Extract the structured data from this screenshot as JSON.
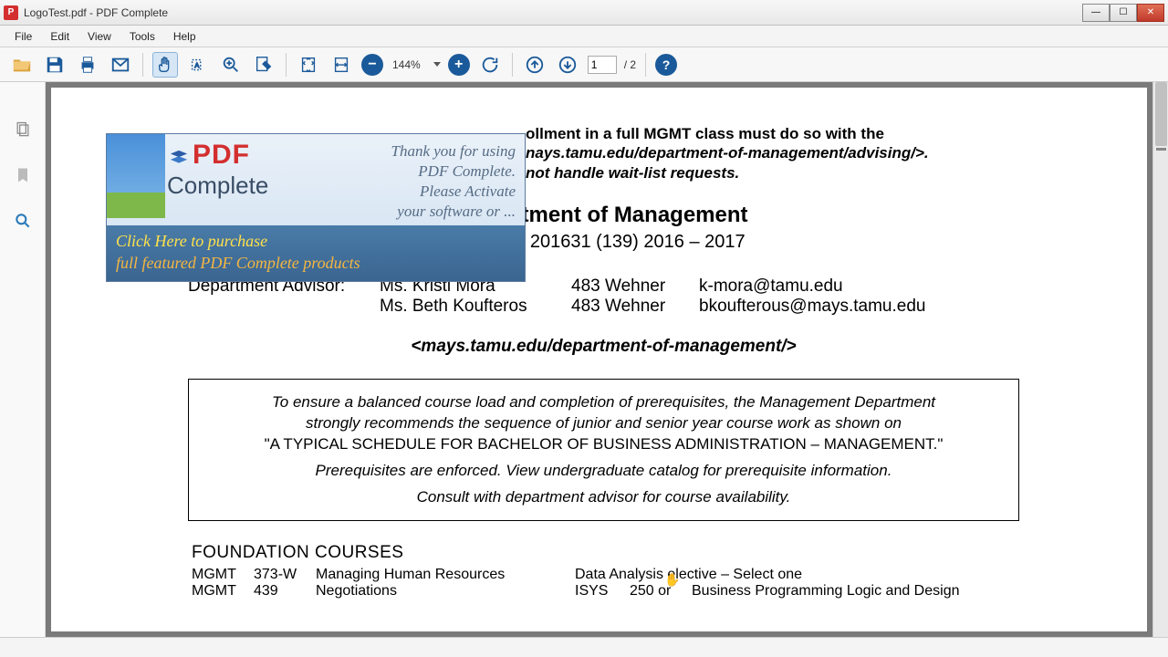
{
  "window": {
    "title": "LogoTest.pdf - PDF Complete"
  },
  "menu": {
    "items": [
      "File",
      "Edit",
      "View",
      "Tools",
      "Help"
    ]
  },
  "toolbar": {
    "zoom_level": "144%",
    "page_current": "1",
    "page_total": "/ 2"
  },
  "watermark": {
    "logo_top": "PDF",
    "logo_bottom": "Complete",
    "thankyou_l1": "Thank you for using",
    "thankyou_l2": "PDF Complete.",
    "thankyou_l3": "Please Activate",
    "thankyou_l4": "your software or ...",
    "cta_l1": "Click Here to purchase",
    "cta_l2": "full featured PDF Complete products"
  },
  "document": {
    "notice_frag1": "ollment in a full MGMT class must do so with the",
    "notice_frag2": "nays.tamu.edu/department-of-management/advising/>.",
    "notice_frag3": "not handle wait-list requests.",
    "dept_title": "Department of Management",
    "catalog_line": "Catalog 201631 (139)   2016 – 2017",
    "advisor_label": "Department Advisor:",
    "advisors": [
      {
        "name": "Ms. Kristi Mora",
        "loc": "483 Wehner",
        "email": "k-mora@tamu.edu"
      },
      {
        "name": "Ms. Beth Koufteros",
        "loc": "483 Wehner",
        "email": "bkoufterous@mays.tamu.edu"
      }
    ],
    "dept_url": "<mays.tamu.edu/department-of-management/>",
    "box_l1": "To ensure a balanced course load and completion of prerequisites, the Management Department",
    "box_l2": "strongly recommends the sequence of junior and senior year course work as shown on",
    "box_l3": "\"A TYPICAL SCHEDULE FOR BACHELOR OF BUSINESS ADMINISTRATION – MANAGEMENT.\"",
    "box_l4": "Prerequisites are enforced.  View undergraduate catalog for prerequisite information.",
    "box_l5": "Consult with department advisor for course availability.",
    "foundation_header": "FOUNDATION COURSES",
    "left_courses": [
      {
        "dept": "MGMT",
        "num": "373-W",
        "title": "Managing Human Resources"
      },
      {
        "dept": "MGMT",
        "num": "439",
        "title": "Negotiations"
      }
    ],
    "right_header": "Data Analysis elective – Select one",
    "right_courses": [
      {
        "dept": "ISYS",
        "num": "250 or",
        "title": "Business Programming Logic and Design"
      }
    ]
  }
}
